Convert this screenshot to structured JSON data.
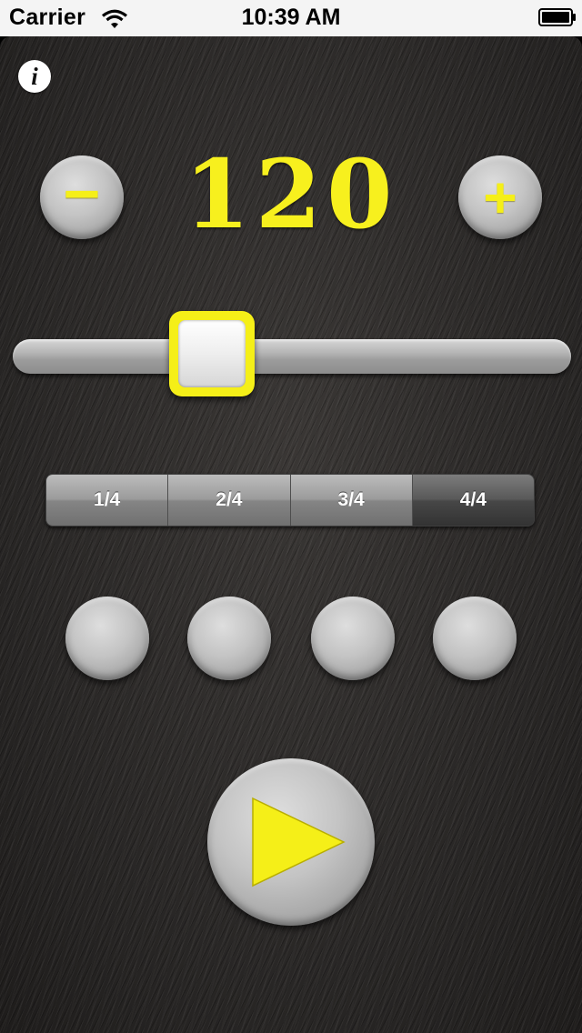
{
  "status_bar": {
    "carrier": "Carrier",
    "time": "10:39 AM",
    "wifi_icon": "wifi-icon",
    "battery_icon": "battery-full-icon"
  },
  "colors": {
    "accent": "#f5ef18",
    "panel_background": "#2c2a29",
    "button_gray": "#c4c4c4"
  },
  "info_button": {
    "glyph": "i",
    "icon": "info-icon"
  },
  "tempo": {
    "value": "120",
    "decrement_label": "−",
    "increment_label": "+"
  },
  "slider": {
    "fraction": 0.33
  },
  "time_signature": {
    "segments": [
      "1/4",
      "2/4",
      "3/4",
      "4/4"
    ],
    "selected": "4/4"
  },
  "beat_lights": {
    "count": 4,
    "active": 0
  },
  "play_button": {
    "icon": "play-icon"
  }
}
